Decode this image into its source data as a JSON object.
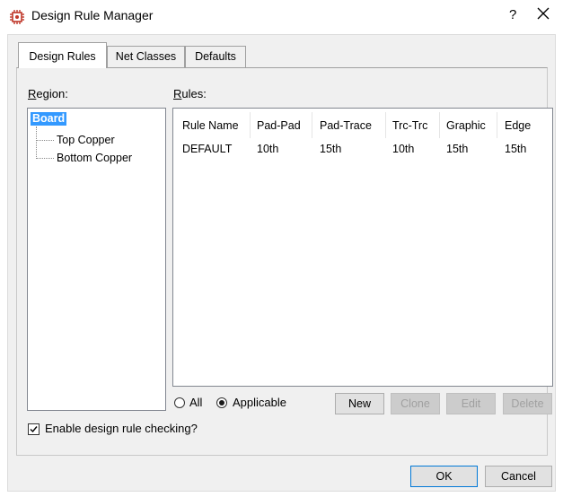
{
  "window": {
    "title": "Design Rule Manager",
    "help": "?",
    "close": "✕"
  },
  "tabs": [
    {
      "label": "Design Rules",
      "active": true
    },
    {
      "label": "Net Classes",
      "active": false
    },
    {
      "label": "Defaults",
      "active": false
    }
  ],
  "region": {
    "label_prefix": "R",
    "label_rest": "egion:",
    "tree": {
      "root": "Board",
      "children": [
        "Top Copper",
        "Bottom Copper"
      ]
    }
  },
  "rules": {
    "label_prefix": "R",
    "label_rest": "ules:",
    "columns": [
      "Rule Name",
      "Pad-Pad",
      "Pad-Trace",
      "Trc-Trc",
      "Graphic",
      "Edge"
    ],
    "rows": [
      [
        "DEFAULT",
        "10th",
        "15th",
        "10th",
        "15th",
        "15th"
      ]
    ]
  },
  "filter": {
    "all_label": "All",
    "applicable_label": "Applicable",
    "selected": "applicable"
  },
  "buttons": {
    "new": "New",
    "clone": "Clone",
    "edit": "Edit",
    "delete": "Delete",
    "ok": "OK",
    "cancel": "Cancel"
  },
  "enable_drc": {
    "label": "Enable design rule checking?",
    "checked": true
  },
  "colors": {
    "selection": "#3399ff",
    "app_icon": "#c0392b"
  }
}
